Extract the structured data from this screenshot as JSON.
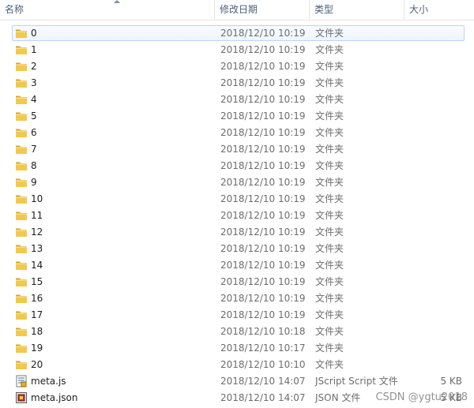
{
  "columns": {
    "name": "名称",
    "date": "修改日期",
    "type": "类型",
    "size": "大小"
  },
  "colors": {
    "folder": "#f2c94c",
    "folder_dark": "#d9a521",
    "focus_border": "#b8d6fb",
    "header_text": "#4c607a"
  },
  "rows": [
    {
      "name": "0",
      "date": "2018/12/10 10:19",
      "type": "文件夹",
      "size": "",
      "icon": "folder-icon"
    },
    {
      "name": "1",
      "date": "2018/12/10 10:19",
      "type": "文件夹",
      "size": "",
      "icon": "folder-icon"
    },
    {
      "name": "2",
      "date": "2018/12/10 10:19",
      "type": "文件夹",
      "size": "",
      "icon": "folder-icon"
    },
    {
      "name": "3",
      "date": "2018/12/10 10:19",
      "type": "文件夹",
      "size": "",
      "icon": "folder-icon"
    },
    {
      "name": "4",
      "date": "2018/12/10 10:19",
      "type": "文件夹",
      "size": "",
      "icon": "folder-icon"
    },
    {
      "name": "5",
      "date": "2018/12/10 10:19",
      "type": "文件夹",
      "size": "",
      "icon": "folder-icon"
    },
    {
      "name": "6",
      "date": "2018/12/10 10:19",
      "type": "文件夹",
      "size": "",
      "icon": "folder-icon"
    },
    {
      "name": "7",
      "date": "2018/12/10 10:19",
      "type": "文件夹",
      "size": "",
      "icon": "folder-icon"
    },
    {
      "name": "8",
      "date": "2018/12/10 10:19",
      "type": "文件夹",
      "size": "",
      "icon": "folder-icon"
    },
    {
      "name": "9",
      "date": "2018/12/10 10:19",
      "type": "文件夹",
      "size": "",
      "icon": "folder-icon"
    },
    {
      "name": "10",
      "date": "2018/12/10 10:19",
      "type": "文件夹",
      "size": "",
      "icon": "folder-icon"
    },
    {
      "name": "11",
      "date": "2018/12/10 10:19",
      "type": "文件夹",
      "size": "",
      "icon": "folder-icon"
    },
    {
      "name": "12",
      "date": "2018/12/10 10:19",
      "type": "文件夹",
      "size": "",
      "icon": "folder-icon"
    },
    {
      "name": "13",
      "date": "2018/12/10 10:19",
      "type": "文件夹",
      "size": "",
      "icon": "folder-icon"
    },
    {
      "name": "14",
      "date": "2018/12/10 10:19",
      "type": "文件夹",
      "size": "",
      "icon": "folder-icon"
    },
    {
      "name": "15",
      "date": "2018/12/10 10:19",
      "type": "文件夹",
      "size": "",
      "icon": "folder-icon"
    },
    {
      "name": "16",
      "date": "2018/12/10 10:19",
      "type": "文件夹",
      "size": "",
      "icon": "folder-icon"
    },
    {
      "name": "17",
      "date": "2018/12/10 10:19",
      "type": "文件夹",
      "size": "",
      "icon": "folder-icon"
    },
    {
      "name": "18",
      "date": "2018/12/10 10:18",
      "type": "文件夹",
      "size": "",
      "icon": "folder-icon"
    },
    {
      "name": "19",
      "date": "2018/12/10 10:17",
      "type": "文件夹",
      "size": "",
      "icon": "folder-icon"
    },
    {
      "name": "20",
      "date": "2018/12/10 10:10",
      "type": "文件夹",
      "size": "",
      "icon": "folder-icon"
    },
    {
      "name": "meta.js",
      "date": "2018/12/10 14:07",
      "type": "JScript Script 文件",
      "size": "5 KB",
      "icon": "jscript-file-icon"
    },
    {
      "name": "meta.json",
      "date": "2018/12/10 14:07",
      "type": "JSON 文件",
      "size": "5 KB",
      "icon": "json-file-icon"
    }
  ],
  "watermark": "CSDN @ygtu2018"
}
